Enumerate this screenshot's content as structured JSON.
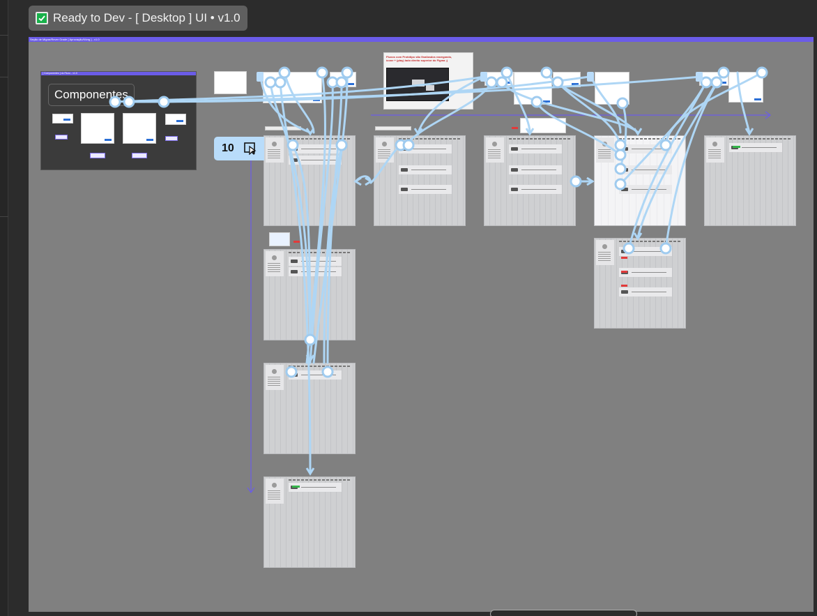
{
  "frame_tag": {
    "label": "Ready to Dev - [ Desktop ] UI • v1.0",
    "icon": "check-icon",
    "icon_color": "#18b14a"
  },
  "board": {
    "crumb": "Seção de Migrar/Rever Grade [ Aprovação/Nívrg ] - v1.0",
    "accent": "#6b5ce8",
    "background": "#808080"
  },
  "components_panel": {
    "bar_label": "[ Componentes ] do Fluxo - v1.0",
    "title": "Componentes"
  },
  "reference_note": {
    "text": "Fluxos com Protótipo são finalizados navegando, ícone + (play) lado direito superior do Figma ;)"
  },
  "prototype_badge": {
    "count": "10",
    "icon": "play-icon"
  },
  "colors": {
    "connector": "#aed6f5",
    "connector_stroke": "#9fcbef",
    "guide": "#6b5ce8"
  }
}
